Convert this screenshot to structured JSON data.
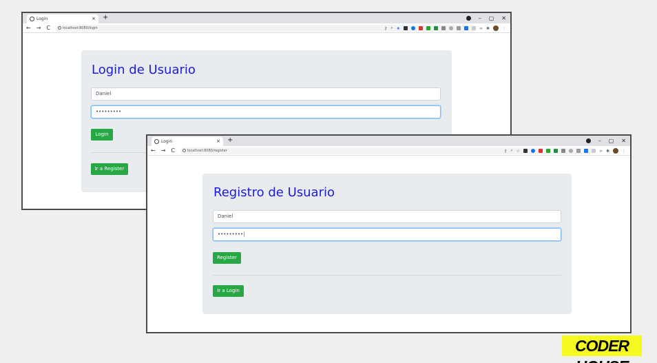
{
  "login_window": {
    "tab_title": "Login",
    "tab_close": "×",
    "new_tab": "+",
    "url": "localhost:8080/login",
    "nav": {
      "back": "←",
      "forward": "→",
      "reload": "C"
    },
    "window_controls": {
      "minimize": "–",
      "maximize": "▢",
      "close": "✕"
    },
    "page": {
      "title": "Login de Usuario",
      "username_value": "Daniel",
      "password_value": "•••••••••",
      "submit_label": "Login",
      "switch_label": "Ir a Register"
    }
  },
  "register_window": {
    "tab_title": "Login",
    "tab_close": "×",
    "new_tab": "+",
    "url": "localhost:8080/register",
    "nav": {
      "back": "←",
      "forward": "→",
      "reload": "C"
    },
    "window_controls": {
      "minimize": "–",
      "maximize": "▢",
      "close": "✕"
    },
    "page": {
      "title": "Registro de Usuario",
      "username_value": "Daniel",
      "password_value": "•••••••••|",
      "submit_label": "Register",
      "switch_label": "Ir a Login"
    }
  },
  "brand": {
    "logo_text": "CODER HOUSE"
  },
  "colors": {
    "accent_button": "#28a745",
    "title_blue": "#1a1ae0",
    "brand_yellow": "#f5f91f"
  }
}
